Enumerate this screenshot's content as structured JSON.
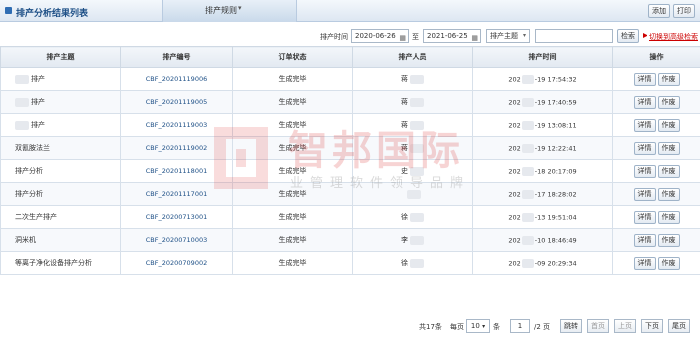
{
  "header": {
    "title": "排产分析结果列表",
    "tab_label": "排产规则",
    "add_label": "添加",
    "print_label": "打印"
  },
  "filter": {
    "time_label": "排产时间",
    "date_from": "2020-06-26",
    "to_label": "至",
    "date_to": "2021-06-25",
    "select_value": "排产主题",
    "search_value": "",
    "search_button": "检索",
    "advanced_link": "切换到高级检索"
  },
  "table": {
    "headers": [
      "排产主题",
      "排产编号",
      "订单状态",
      "排产人员",
      "排产时间",
      "操作"
    ],
    "rows": [
      {
        "topic": "排产",
        "code": "CBF_20201119006",
        "status": "生成完毕",
        "person": "蒋",
        "time": "-19 17:54:32",
        "time_prefix": "202"
      },
      {
        "topic": "排产",
        "code": "CBF_20201119005",
        "status": "生成完毕",
        "person": "蒋",
        "time": "-19 17:40:59",
        "time_prefix": "202"
      },
      {
        "topic": "排产",
        "code": "CBF_20201119003",
        "status": "生成完毕",
        "person": "蒋",
        "time": "-19 13:08:11",
        "time_prefix": "202"
      },
      {
        "topic": "双氰胺法兰",
        "code": "CBF_20201119002",
        "status": "生成完毕",
        "person": "蒋",
        "time": "-19 12:22:41",
        "time_prefix": "202"
      },
      {
        "topic": "排产分析",
        "code": "CBF_20201118001",
        "status": "生成完毕",
        "person": "史",
        "time": "-18 20:17:09",
        "time_prefix": "202"
      },
      {
        "topic": "排产分析",
        "code": "CBF_20201117001",
        "status": "生成完毕",
        "person": "",
        "time": "-17 18:28:02",
        "time_prefix": "202"
      },
      {
        "topic": "二次生产排产",
        "code": "CBF_20200713001",
        "status": "生成完毕",
        "person": "徐",
        "time": "-13 19:51:04",
        "time_prefix": "202"
      },
      {
        "topic": "洞米机",
        "code": "CBF_20200710003",
        "status": "生成完毕",
        "person": "李",
        "time": "-10 18:46:49",
        "time_prefix": "202"
      },
      {
        "topic": "等离子净化设备排产分析",
        "code": "CBF_20200709002",
        "status": "生成完毕",
        "person": "徐",
        "time": "-09 20:29:34",
        "time_prefix": "202"
      }
    ],
    "op_detail": "详情",
    "op_delete": "作废"
  },
  "watermark": {
    "text": "智邦国际",
    "subtext": "业管理软件领导品牌"
  },
  "pager": {
    "total": "共17条",
    "per_page_label": "每页",
    "per_page_value": "10",
    "unit": "条",
    "page_value": "1",
    "page_total": "/2 页",
    "jump": "跳转",
    "first": "首页",
    "prev": "上页",
    "next": "下页",
    "last": "尾页"
  }
}
